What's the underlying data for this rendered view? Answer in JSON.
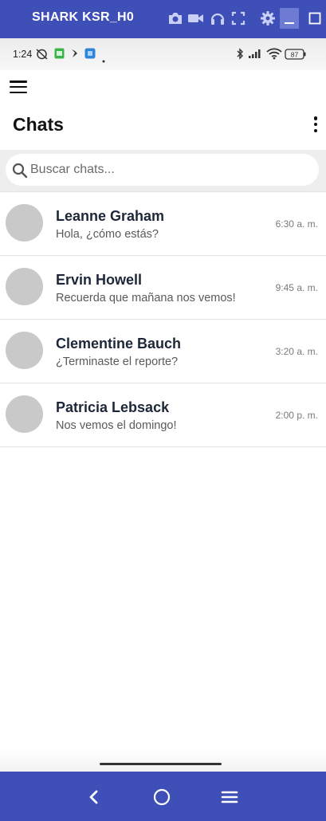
{
  "emulator": {
    "title": "SHARK KSR_H0",
    "icons": [
      "camera-icon",
      "video-icon",
      "headphones-icon",
      "fullscreen-icon",
      "gear-icon",
      "minimize-icon",
      "maximize-icon"
    ]
  },
  "status_bar": {
    "time": "1:24",
    "battery": "87",
    "icons": [
      "alarm-off-icon",
      "app-notification-icon",
      "shoe-icon",
      "app-square-icon",
      "dot-icon",
      "bluetooth-icon",
      "signal-icon",
      "wifi-icon",
      "battery-icon"
    ]
  },
  "header": {
    "title": "Chats",
    "menu_icon": "hamburger-icon",
    "more_icon": "more-vert-icon"
  },
  "search": {
    "placeholder": "Buscar chats...",
    "value": ""
  },
  "chats": [
    {
      "name": "Leanne Graham",
      "message": "Hola, ¿cómo estás?",
      "time": "6:30 a. m."
    },
    {
      "name": "Ervin Howell",
      "message": "Recuerda que mañana nos vemos!",
      "time": "9:45 a. m."
    },
    {
      "name": "Clementine Bauch",
      "message": "¿Terminaste el reporte?",
      "time": "3:20 a. m."
    },
    {
      "name": "Patricia Lebsack",
      "message": "Nos vemos el domingo!",
      "time": "2:00 p. m."
    }
  ],
  "nav": {
    "icons": [
      "back-icon",
      "home-icon",
      "menu-icon"
    ]
  },
  "colors": {
    "emulator_bar": "#3f4fb8",
    "avatar": "#c9c9c9",
    "name_text": "#1d2738"
  }
}
